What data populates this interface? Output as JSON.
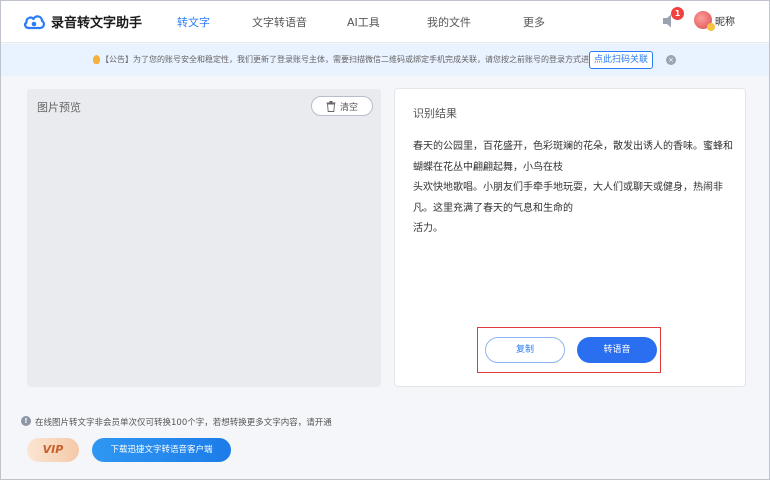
{
  "header": {
    "app_title": "录音转文字助手",
    "nav": [
      "转文字",
      "文字转语音",
      "AI工具",
      "我的文件",
      "更多"
    ],
    "notification_count": "1",
    "nickname": "昵称"
  },
  "notice": {
    "text": "【公告】为了您的账号安全和稳定性，我们更新了登录账号主体，需要扫描微信二维码或绑定手机完成关联，请您按之前账号的登录方式进行关联。",
    "button": "点此扫码关联",
    "close": "×"
  },
  "preview": {
    "title": "图片预览",
    "clear_label": "清空"
  },
  "result": {
    "title": "识别结果",
    "lines": [
      "春天的公园里，百花盛开，色彩斑斓的花朵，散发出诱人的香味。蜜蜂和",
      "蝴蝶在花丛中翩翩起舞，小鸟在枝",
      "头欢快地歌唱。小朋友们手牵手地玩耍，大人们或聊天或健身，热闹非",
      "凡。这里充满了春天的气息和生命的",
      "活力。"
    ],
    "copy_label": "复制",
    "to_speech_label": "转语音"
  },
  "footer": {
    "info_text": "在线图片转文字非会员单次仅可转换100个字，若想转换更多文字内容，请开通",
    "vip_label": "VIP",
    "download_label": "下载迅捷文字转语音客户端"
  },
  "colors": {
    "accent": "#2a7cf6",
    "highlight_border": "#e03a3a"
  }
}
